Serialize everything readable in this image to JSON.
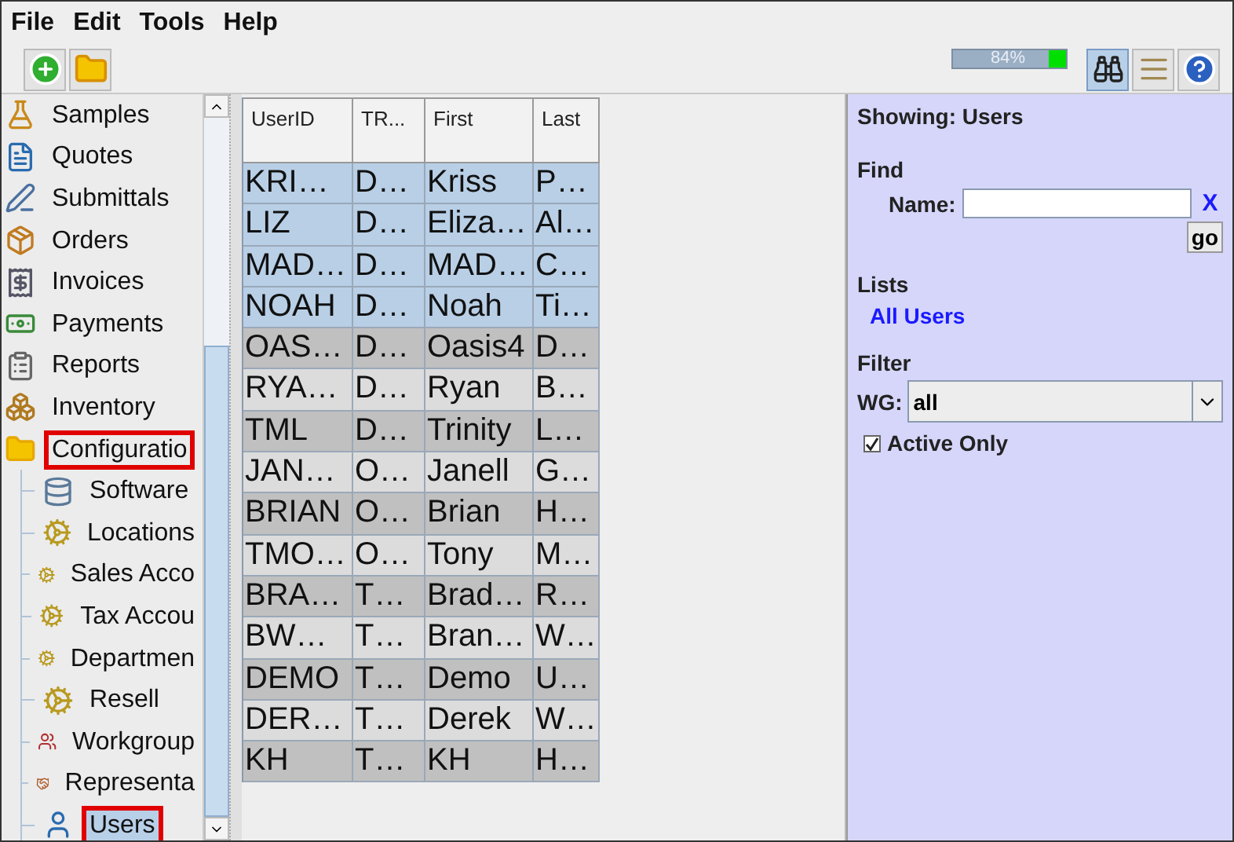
{
  "menu": [
    "File",
    "Edit",
    "Tools",
    "Help"
  ],
  "memory": {
    "reading": "84%"
  },
  "tool_buttons": [
    {
      "kind": "find",
      "pressed": true
    },
    {
      "kind": "list",
      "pressed": false
    },
    {
      "kind": "help",
      "pressed": false
    }
  ],
  "sidebar": {
    "items": [
      {
        "label": "Samples",
        "kind": "samples",
        "selected": false,
        "marked": false
      },
      {
        "label": "Quotes",
        "kind": "quotes",
        "selected": false,
        "marked": false
      },
      {
        "label": "Submittals",
        "kind": "submittals",
        "selected": false,
        "marked": false
      },
      {
        "label": "Orders",
        "kind": "orders",
        "selected": false,
        "marked": false
      },
      {
        "label": "Invoices",
        "kind": "invoices",
        "selected": false,
        "marked": false
      },
      {
        "label": "Payments",
        "kind": "payments",
        "selected": false,
        "marked": false
      },
      {
        "label": "Reports",
        "kind": "reports",
        "selected": false,
        "marked": false
      },
      {
        "label": "Inventory",
        "kind": "inventory",
        "selected": false,
        "marked": false
      },
      {
        "label": "Configuratio",
        "kind": "folder",
        "selected": false,
        "marked": true,
        "expanded": true,
        "children": [
          {
            "label": "Software",
            "kind": "software",
            "selected": false,
            "marked": false
          },
          {
            "label": "Locations",
            "kind": "gears",
            "selected": false,
            "marked": false
          },
          {
            "label": "Sales Acco",
            "kind": "gears",
            "selected": false,
            "marked": false
          },
          {
            "label": "Tax Accou",
            "kind": "gears",
            "selected": false,
            "marked": false
          },
          {
            "label": "Departmen",
            "kind": "gears",
            "selected": false,
            "marked": false
          },
          {
            "label": "Resell",
            "kind": "gears",
            "selected": false,
            "marked": false
          },
          {
            "label": "Workgroup",
            "kind": "group",
            "selected": false,
            "marked": false
          },
          {
            "label": "Representa",
            "kind": "hands",
            "selected": false,
            "marked": false
          },
          {
            "label": "Users",
            "kind": "user",
            "selected": true,
            "marked": true
          }
        ]
      }
    ]
  },
  "table": {
    "columns": [
      "UserID",
      "TR...",
      "First",
      "Last"
    ],
    "rows": [
      {
        "cells": [
          "KRI…",
          "D…",
          "Kriss",
          "P…"
        ],
        "selected": true
      },
      {
        "cells": [
          "LIZ",
          "D…",
          "Eliza…",
          "Al…"
        ],
        "selected": true
      },
      {
        "cells": [
          "MAD…",
          "D…",
          "MAD…",
          "C…"
        ],
        "selected": true
      },
      {
        "cells": [
          "NOAH",
          "D…",
          "Noah",
          "Ti…"
        ],
        "selected": true
      },
      {
        "cells": [
          "OAS…",
          "D…",
          "Oasis4",
          "D…"
        ],
        "selected": false
      },
      {
        "cells": [
          "RYA…",
          "D…",
          "Ryan",
          "B…"
        ],
        "selected": false
      },
      {
        "cells": [
          "TML",
          "D…",
          "Trinity",
          "L…"
        ],
        "selected": false
      },
      {
        "cells": [
          "JAN…",
          "O…",
          "Janell",
          "G…"
        ],
        "selected": false
      },
      {
        "cells": [
          "BRIAN",
          "O…",
          "Brian",
          "H…"
        ],
        "selected": false
      },
      {
        "cells": [
          "TMO…",
          "O…",
          "Tony",
          "M…"
        ],
        "selected": false
      },
      {
        "cells": [
          "BRA…",
          "T…",
          "Brad…",
          "R…"
        ],
        "selected": false
      },
      {
        "cells": [
          "BW…",
          "T…",
          "Bran…",
          "W…"
        ],
        "selected": false
      },
      {
        "cells": [
          "DEMO",
          "T…",
          "Demo",
          "U…"
        ],
        "selected": false
      },
      {
        "cells": [
          "DER…",
          "T…",
          "Derek",
          "W…"
        ],
        "selected": false
      },
      {
        "cells": [
          "KH",
          "T…",
          "KH",
          "H…"
        ],
        "selected": false
      }
    ]
  },
  "panel": {
    "showing": "Showing: Users",
    "find_heading": "Find",
    "name_label": "Name:",
    "clear": "X",
    "go": "go",
    "lists_heading": "Lists",
    "lists": [
      "All Users"
    ],
    "filter_heading": "Filter",
    "wg_label": "WG:",
    "wg_value": "all",
    "active_only": {
      "label": "Active Only",
      "checked": true
    }
  }
}
